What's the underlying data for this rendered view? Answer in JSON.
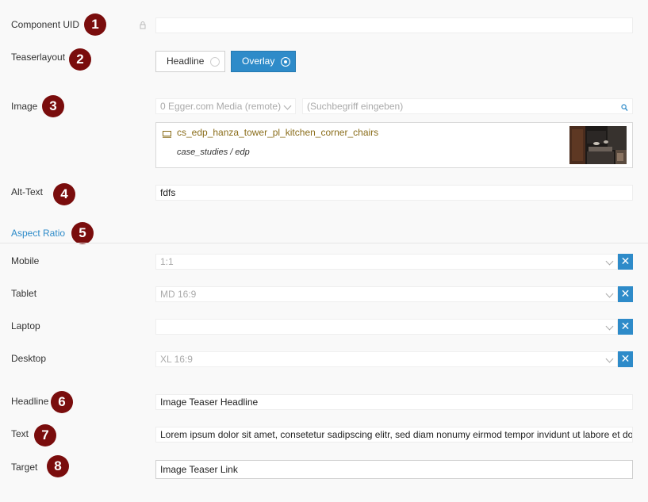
{
  "fields": {
    "component_uid": {
      "label": "Component UID",
      "value": "",
      "badge": "1"
    },
    "teaserlayout": {
      "label": "Teaserlayout",
      "badge": "2",
      "options": [
        {
          "label": "Headline",
          "selected": false
        },
        {
          "label": "Overlay",
          "selected": true
        }
      ]
    },
    "image": {
      "label": "Image",
      "badge": "3",
      "source_select": "0 Egger.com Media (remote)",
      "search_placeholder": "(Suchbegriff eingeben)",
      "media_name": "cs_edp_hanza_tower_pl_kitchen_corner_chairs",
      "media_path": "case_studies / edp"
    },
    "alt_text": {
      "label": "Alt-Text",
      "value": "fdfs",
      "badge": "4"
    },
    "aspect_ratio": {
      "label": "Aspect Ratio",
      "badge": "5",
      "rows": [
        {
          "label": "Mobile",
          "value": "1:1"
        },
        {
          "label": "Tablet",
          "value": "MD 16:9"
        },
        {
          "label": "Laptop",
          "value": ""
        },
        {
          "label": "Desktop",
          "value": "XL 16:9"
        }
      ],
      "clear_glyph": "✕"
    },
    "headline": {
      "label": "Headline",
      "value": "Image Teaser Headline",
      "badge": "6"
    },
    "text": {
      "label": "Text",
      "value": "Lorem ipsum dolor sit amet, consetetur sadipscing elitr, sed diam nonumy eirmod tempor invidunt ut labore et dolore magna aliquyam erat",
      "badge": "7"
    },
    "target": {
      "label": "Target",
      "value": "Image Teaser Link",
      "badge": "8"
    }
  },
  "colors": {
    "accent": "#2e8bc9",
    "badge": "#7a0d0d",
    "media_link": "#8a6d1a"
  }
}
